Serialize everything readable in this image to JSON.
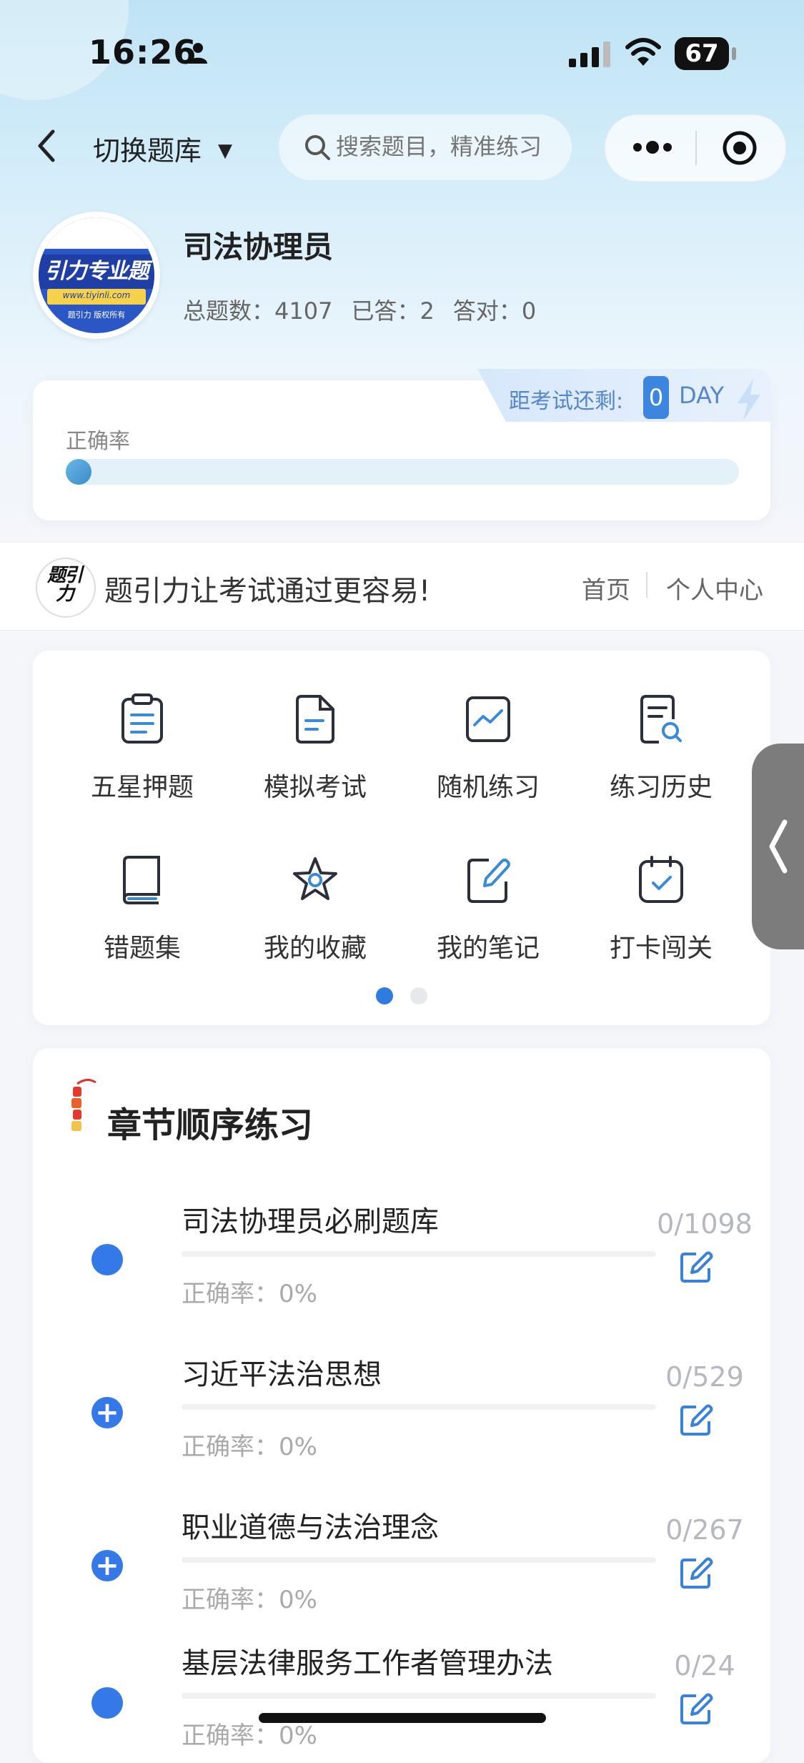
{
  "status_bar": {
    "time": "16:26",
    "battery": "67"
  },
  "nav": {
    "switch_label": "切换题库",
    "search_placeholder": "搜索题目，精准练习"
  },
  "bank": {
    "title": "司法协理员",
    "total": "总题数：4107",
    "answered": "已答：2",
    "correct": "答对：0",
    "avatar_text": "引力专业题",
    "avatar_url": "www.tiyinli.com",
    "avatar_copyright": "题引力 版权所有"
  },
  "accuracy": {
    "label": "正确率",
    "value": 0,
    "countdown_label": "距考试还剩:",
    "days": "0",
    "day_unit": "DAY"
  },
  "slogan": {
    "logo_text": "题引力",
    "text": "题引力让考试通过更容易!",
    "home": "首页",
    "user_center": "个人中心"
  },
  "features": [
    {
      "label": "五星押题",
      "icon": "clipboard-icon"
    },
    {
      "label": "模拟考试",
      "icon": "document-icon"
    },
    {
      "label": "随机练习",
      "icon": "chart-line-icon"
    },
    {
      "label": "练习历史",
      "icon": "history-search-icon"
    },
    {
      "label": "错题集",
      "icon": "book-icon"
    },
    {
      "label": "我的收藏",
      "icon": "star-icon"
    },
    {
      "label": "我的笔记",
      "icon": "note-edit-icon"
    },
    {
      "label": "打卡闯关",
      "icon": "calendar-check-icon"
    }
  ],
  "pager": {
    "active": 1,
    "total": 2
  },
  "chapters": {
    "title": "章节顺序练习",
    "items": [
      {
        "name": "司法协理员必刷题库",
        "rate": "正确率：0%",
        "count": "0/1098",
        "bullet": "dot"
      },
      {
        "name": "习近平法治思想",
        "rate": "正确率：0%",
        "count": "0/529",
        "bullet": "plus"
      },
      {
        "name": "职业道德与法治理念",
        "rate": "正确率：0%",
        "count": "0/267",
        "bullet": "plus"
      },
      {
        "name": "基层法律服务工作者管理办法",
        "rate": "正确率：0%",
        "count": "0/24",
        "bullet": "dot"
      }
    ]
  },
  "colors": {
    "accent": "#3578e8",
    "countdown": "#5686c9"
  }
}
